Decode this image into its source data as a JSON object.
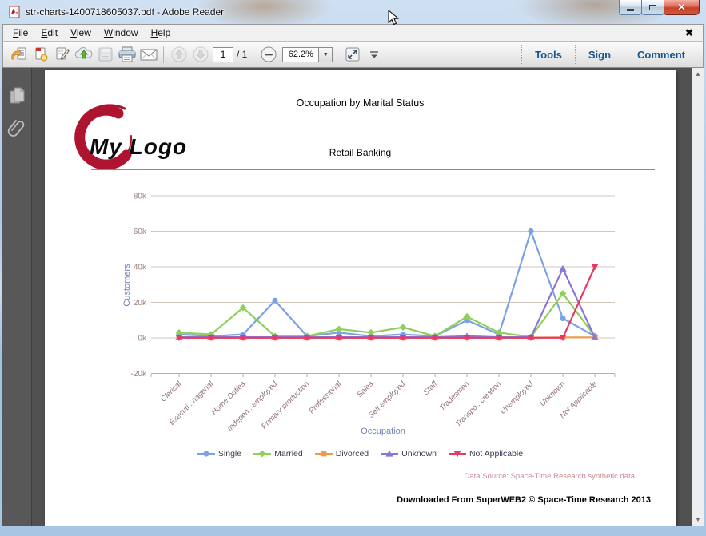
{
  "window": {
    "title": "str-charts-1400718605037.pdf - Adobe Reader"
  },
  "menubar": {
    "items": [
      "File",
      "Edit",
      "View",
      "Window",
      "Help"
    ],
    "close_document_label": "✖"
  },
  "toolbar": {
    "page_current": "1",
    "page_total": "/ 1",
    "zoom_value": "62.2%",
    "tools_label": "Tools",
    "sign_label": "Sign",
    "comment_label": "Comment",
    "icons": [
      "open-icon",
      "create-pdf-icon",
      "sign-document-icon",
      "cloud-upload-icon",
      "save-icon",
      "print-icon",
      "email-icon",
      "previous-page-icon",
      "next-page-icon",
      "zoom-out-icon",
      "fit-window-icon",
      "toolbar-overflow-icon"
    ]
  },
  "sidebar": {
    "icons": [
      "page-thumbnails-icon",
      "attachments-paperclip-icon"
    ]
  },
  "scrollbar": {
    "up_arrow": "▲",
    "down_arrow": "▼"
  },
  "page": {
    "title": "Occupation by Marital Status",
    "subtitle": "Retail Banking",
    "logo_text": "My Logo",
    "data_source": "Data Source: Space-Time Research synthetic data",
    "footer": "Downloaded From SuperWEB2 © Space-Time Research 2013"
  },
  "chart_data": {
    "type": "line",
    "title": "Occupation by Marital Status",
    "xlabel": "Occupation",
    "ylabel": "Customers",
    "value_unit": "thousands (k)",
    "ylim_k": [
      -20,
      80
    ],
    "yticks_k": [
      80,
      60,
      40,
      20,
      0,
      -20
    ],
    "ytick_labels": [
      "80k",
      "60k",
      "40k",
      "20k",
      "0k",
      "-20k"
    ],
    "grid": true,
    "legend_position": "bottom",
    "categories": [
      "Clerical",
      "Executi...nagerial",
      "Home Duties",
      "Indepen...employed",
      "Primary production",
      "Professional",
      "Sales",
      "Self employed",
      "Staff",
      "Tradesmen",
      "Transpo...creation",
      "Unemployed",
      "Unknown",
      "Not Applicable"
    ],
    "series": [
      {
        "name": "Single",
        "color": "#7ba2e4",
        "marker": "circle",
        "values_k": [
          2,
          1,
          2,
          21,
          1,
          3,
          1,
          2,
          1,
          10,
          2,
          60,
          11,
          1
        ]
      },
      {
        "name": "Married",
        "color": "#8ed05a",
        "marker": "diamond",
        "values_k": [
          3,
          2,
          17,
          1,
          1,
          5,
          3,
          6,
          1,
          12,
          3,
          0.5,
          25,
          1
        ]
      },
      {
        "name": "Divorced",
        "color": "#f09a4a",
        "marker": "square",
        "values_k": [
          0.2,
          0.2,
          0.2,
          0.2,
          0.2,
          0.2,
          0.2,
          0.2,
          0.2,
          0.2,
          0.2,
          0.2,
          0.3,
          0.3
        ]
      },
      {
        "name": "Unknown",
        "color": "#8677d9",
        "marker": "triangle-up",
        "values_k": [
          0.4,
          0.4,
          0.4,
          0.4,
          0.4,
          0.4,
          0.4,
          0.4,
          0.4,
          1,
          0.4,
          0.4,
          39,
          0.3
        ]
      },
      {
        "name": "Not Applicable",
        "color": "#e63a64",
        "marker": "triangle-down",
        "values_k": [
          0.1,
          0.1,
          0.1,
          0.1,
          0.1,
          0.1,
          0.1,
          0.1,
          0.1,
          0.1,
          0.1,
          0.1,
          0.1,
          40
        ]
      }
    ],
    "colors": {
      "gridline": "#d4c6bb",
      "axis_line": "#a9aed6",
      "ytick_text": "#9c8084",
      "xtick_text": "#8d6d80",
      "axis_title_text": "#7282b8"
    }
  }
}
